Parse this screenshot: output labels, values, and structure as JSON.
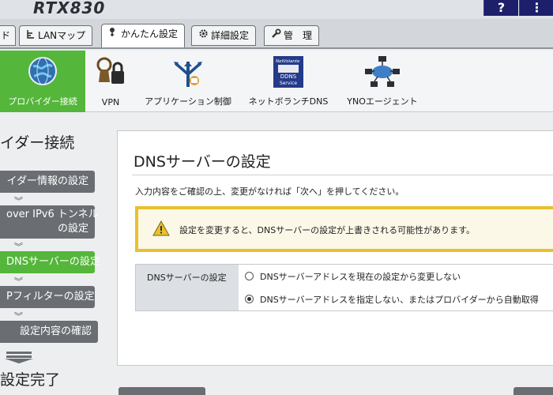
{
  "header": {
    "brand": "RTX830",
    "help_label": "?",
    "menu_label": "⋮"
  },
  "tabs": [
    {
      "label": "ド",
      "icon": "dashboard-icon"
    },
    {
      "label": "LANマップ",
      "icon": "lan-map-icon"
    },
    {
      "label": "かんたん設定",
      "icon": "wizard-icon"
    },
    {
      "label": "詳細設定",
      "icon": "gear-icon"
    },
    {
      "label": "管　理",
      "icon": "wrench-icon"
    }
  ],
  "categories": [
    {
      "label": "プロバイダー接続",
      "icon": "globe-icon"
    },
    {
      "label": "VPN",
      "icon": "vpn-lock-icon"
    },
    {
      "label": "アプリケーション制御",
      "icon": "application-control-icon"
    },
    {
      "label": "ネットボランチDNS",
      "icon": "ddns-service-icon"
    },
    {
      "label": "YNOエージェント",
      "icon": "yno-agent-icon"
    }
  ],
  "ddns_icon_text": {
    "line1": "NetVolante",
    "line2": "DDNS",
    "line3": "Service"
  },
  "sidebar": {
    "title": "イダー接続",
    "steps": [
      {
        "label": "イダー情報の設定"
      },
      {
        "label_line1": "over IPv6 トンネル",
        "label_line2": "の設定"
      },
      {
        "label": "DNSサーバーの設定"
      },
      {
        "label": "Pフィルターの設定"
      },
      {
        "label": "設定内容の確認"
      }
    ],
    "finish": "設定完了",
    "chevron": "︾"
  },
  "main": {
    "title": "DNSサーバーの設定",
    "instruction": "入力内容をご確認の上、変更がなければ「次へ」を押してください。",
    "warning": "設定を変更すると、DNSサーバーの設定が上書きされる可能性があります。",
    "setting_label": "DNSサーバーの設定",
    "options": [
      {
        "label": "DNSサーバーアドレスを現在の設定から変更しない",
        "selected": false
      },
      {
        "label": "DNSサーバーアドレスを指定しない、またはプロバイダーから自動取得",
        "selected": true
      }
    ]
  },
  "colors": {
    "accent_green": "#54b63a",
    "warning_yellow": "#e9c02e",
    "header_navy": "#1e1f6a",
    "step_gray": "#6a6e73"
  }
}
